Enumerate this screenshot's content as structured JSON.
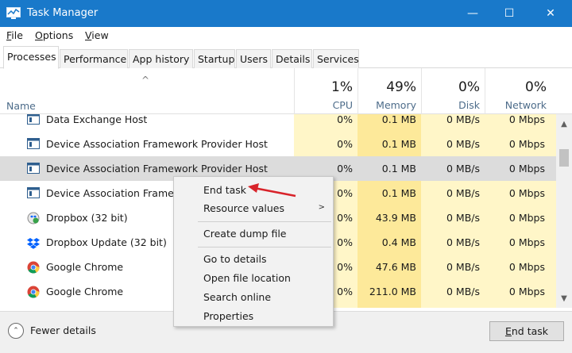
{
  "window": {
    "title": "Task Manager",
    "minimize": "—",
    "maximize": "☐",
    "close": "✕"
  },
  "menu": [
    {
      "first": "F",
      "rest": "ile"
    },
    {
      "first": "O",
      "rest": "ptions"
    },
    {
      "first": "V",
      "rest": "iew"
    }
  ],
  "tabs": [
    "Processes",
    "Performance",
    "App history",
    "Startup",
    "Users",
    "Details",
    "Services"
  ],
  "active_tab": "Processes",
  "header": {
    "sort_arrow": "^",
    "name_label": "Name",
    "cpu": {
      "pct": "1%",
      "label": "CPU"
    },
    "memory": {
      "pct": "49%",
      "label": "Memory"
    },
    "disk": {
      "pct": "0%",
      "label": "Disk"
    },
    "network": {
      "pct": "0%",
      "label": "Network"
    }
  },
  "rows": [
    {
      "name": "Data Exchange Host",
      "icon": "window-icon",
      "cpu": "0%",
      "memory": "0.1 MB",
      "disk": "0 MB/s",
      "network": "0 Mbps"
    },
    {
      "name": "Device Association Framework Provider Host",
      "icon": "window-icon",
      "cpu": "0%",
      "memory": "0.1 MB",
      "disk": "0 MB/s",
      "network": "0 Mbps"
    },
    {
      "name": "Device Association Framework Provider Host",
      "icon": "window-icon",
      "cpu": "0%",
      "memory": "0.1 MB",
      "disk": "0 MB/s",
      "network": "0 Mbps",
      "selected": true
    },
    {
      "name": "Device Association Framew",
      "icon": "window-icon",
      "cpu": "0%",
      "memory": "0.1 MB",
      "disk": "0 MB/s",
      "network": "0 Mbps"
    },
    {
      "name": "Dropbox (32 bit)",
      "icon": "dropbox-sync-icon",
      "cpu": "0%",
      "memory": "43.9 MB",
      "disk": "0 MB/s",
      "network": "0 Mbps"
    },
    {
      "name": "Dropbox Update (32 bit)",
      "icon": "dropbox-icon",
      "cpu": "0%",
      "memory": "0.4 MB",
      "disk": "0 MB/s",
      "network": "0 Mbps"
    },
    {
      "name": "Google Chrome",
      "icon": "chrome-icon",
      "cpu": "0%",
      "memory": "47.6 MB",
      "disk": "0 MB/s",
      "network": "0 Mbps"
    },
    {
      "name": "Google Chrome",
      "icon": "chrome-icon",
      "cpu": "0%",
      "memory": "211.0 MB",
      "disk": "0 MB/s",
      "network": "0 Mbps"
    }
  ],
  "context_menu": {
    "items": [
      "End task",
      "Resource values",
      "Create dump file",
      "Go to details",
      "Open file location",
      "Search online",
      "Properties"
    ],
    "submenu_arrow": ">"
  },
  "footer": {
    "fewer_details_icon": "⌃",
    "fewer_details": "Fewer details",
    "end_task_first": "E",
    "end_task_rest": "nd task"
  },
  "scrollbar": {
    "up": "▲",
    "down": "▼"
  },
  "colors": {
    "titlebar": "#1979ca",
    "highlight_column": "#fff6c8",
    "memory_column": "#fde99a",
    "arrow": "#d8232a"
  }
}
